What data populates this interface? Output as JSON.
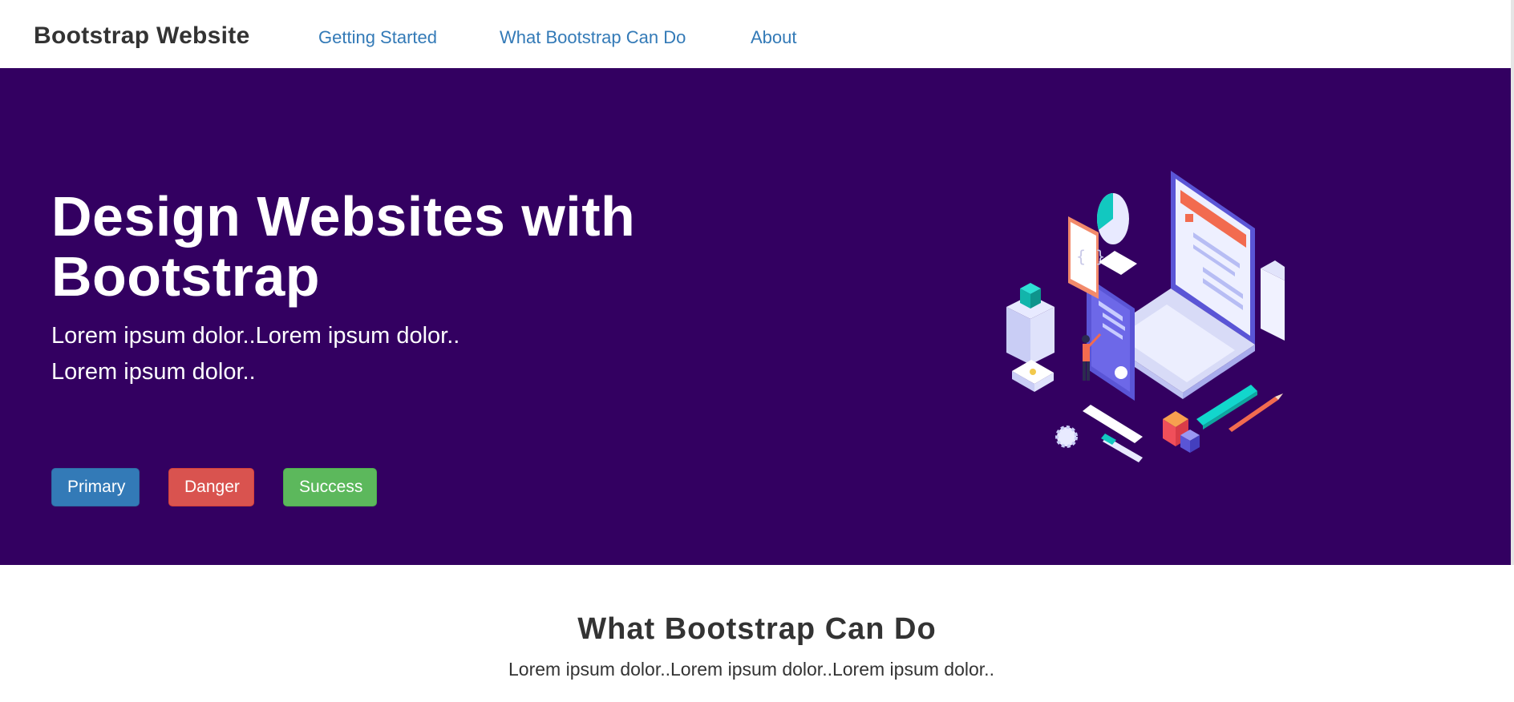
{
  "navbar": {
    "brand": "Bootstrap Website",
    "links": [
      "Getting Started",
      "What Bootstrap Can Do",
      "About"
    ]
  },
  "hero": {
    "title": "Design Websites with Bootstrap",
    "lines": [
      "Lorem ipsum dolor..Lorem ipsum dolor..",
      "Lorem ipsum dolor.."
    ],
    "buttons": {
      "primary": "Primary",
      "danger": "Danger",
      "success": "Success"
    },
    "background_color": "#330061",
    "illustration": "isometric-laptop-developer-illustration"
  },
  "section": {
    "title": "What Bootstrap Can Do",
    "text": "Lorem ipsum dolor..Lorem ipsum dolor..Lorem ipsum dolor.."
  },
  "colors": {
    "link": "#337ab7",
    "primary": "#337ab7",
    "danger": "#d9534f",
    "success": "#5cb85c"
  }
}
